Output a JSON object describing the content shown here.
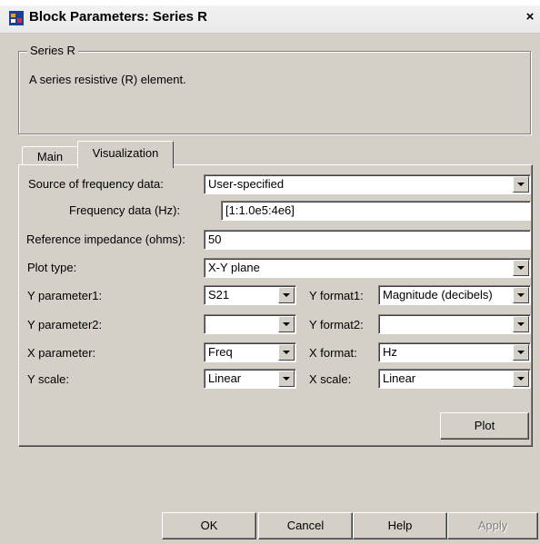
{
  "window": {
    "title": "Block Parameters: Series R",
    "close_label": "×"
  },
  "group": {
    "legend": "Series R",
    "description": "A series resistive (R) element."
  },
  "tabs": [
    {
      "label": "Main",
      "active": false
    },
    {
      "label": "Visualization",
      "active": true
    }
  ],
  "form": {
    "source_label": "Source of frequency data:",
    "source_value": "User-specified",
    "freq_label": "Frequency data (Hz):",
    "freq_value": "[1:1.0e5:4e6]",
    "ref_label": "Reference impedance (ohms):",
    "ref_value": "50",
    "plot_type_label": "Plot type:",
    "plot_type_value": "X-Y plane",
    "y_param1_label": "Y parameter1:",
    "y_param1_value": "S21",
    "y_format1_label": "Y format1:",
    "y_format1_value": "Magnitude (decibels)",
    "y_param2_label": "Y parameter2:",
    "y_param2_value": "",
    "y_format2_label": "Y format2:",
    "y_format2_value": "",
    "x_param_label": "X parameter:",
    "x_param_value": "Freq",
    "x_format_label": "X format:",
    "x_format_value": "Hz",
    "y_scale_label": "Y scale:",
    "y_scale_value": "Linear",
    "x_scale_label": "X scale:",
    "x_scale_value": "Linear",
    "plot_button": "Plot"
  },
  "buttons": {
    "ok": "OK",
    "cancel": "Cancel",
    "help": "Help",
    "apply": "Apply"
  },
  "icons": {
    "title_icon": "simulink-block-icon",
    "dropdown": "chevron-down-icon"
  }
}
